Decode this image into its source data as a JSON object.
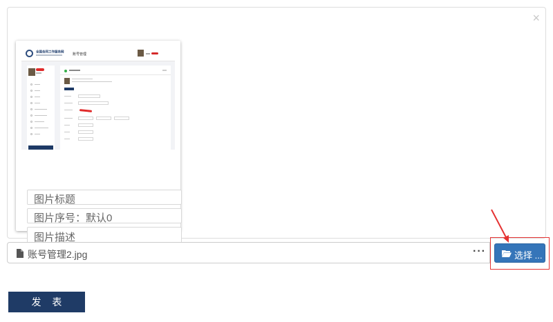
{
  "preview": {
    "close_label": "×",
    "thumbnail": {
      "brand": "全国合同工作服务网",
      "nav_label": "账号管理",
      "icon": "image-thumbnail"
    },
    "title_placeholder": "图片标题",
    "order_placeholder": "图片序号：默认0",
    "description_placeholder": "图片描述"
  },
  "file_input": {
    "file_name": "账号管理2.jpg",
    "more_label": "···",
    "choose_label": "选择 ...",
    "file_icon": "file-icon",
    "folder_icon": "folder-open-icon"
  },
  "annotation": {
    "highlight_color": "#e53333"
  },
  "publish_label": "发 表",
  "colors": {
    "primary": "#1f3b66",
    "choose_button": "#3575b9",
    "border": "#dddddd"
  }
}
